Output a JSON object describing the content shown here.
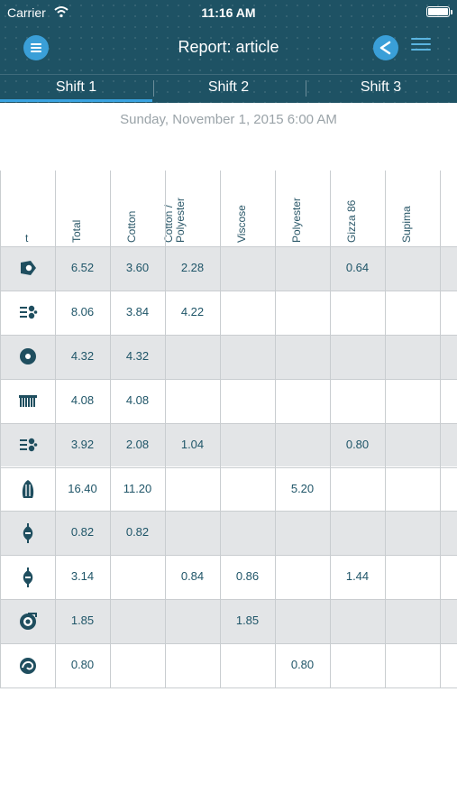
{
  "status_bar": {
    "carrier": "Carrier",
    "time": "11:16 AM"
  },
  "nav": {
    "title": "Report: article",
    "menu_icon": "menu-icon",
    "share_icon": "share-icon",
    "list_icon": "list-icon"
  },
  "tabs": [
    {
      "label": "Shift 1",
      "active": true
    },
    {
      "label": "Shift 2",
      "active": false
    },
    {
      "label": "Shift 3",
      "active": false
    }
  ],
  "date": "Sunday, November 1, 2015 6:00 AM",
  "table": {
    "first_header": "t",
    "columns": [
      {
        "line1": "Total"
      },
      {
        "line1": "Cotton"
      },
      {
        "line1": "Cotton /",
        "line2": "Polyester"
      },
      {
        "line1": "Viscose"
      },
      {
        "line1": "Polyester"
      },
      {
        "line1": "Gizza 86"
      },
      {
        "line1": "Supima"
      }
    ],
    "rows": [
      {
        "icon": "bale-opener-icon",
        "cells": [
          "6.52",
          "3.60",
          "2.28",
          "",
          "",
          "0.64",
          ""
        ]
      },
      {
        "icon": "blowroom-icon",
        "cells": [
          "8.06",
          "3.84",
          "4.22",
          "",
          "",
          "",
          ""
        ]
      },
      {
        "icon": "card-icon",
        "cells": [
          "4.32",
          "4.32",
          "",
          "",
          "",
          "",
          ""
        ]
      },
      {
        "icon": "comber-icon",
        "cells": [
          "4.08",
          "4.08",
          "",
          "",
          "",
          "",
          ""
        ]
      },
      {
        "icon": "blowroom-icon",
        "cells": [
          "3.92",
          "2.08",
          "1.04",
          "",
          "",
          "0.80",
          ""
        ]
      },
      {
        "icon": "draw-frame-icon",
        "cells": [
          "16.40",
          "11.20",
          "",
          "",
          "5.20",
          "",
          ""
        ]
      },
      {
        "icon": "roving-bobbin-icon",
        "cells": [
          "0.82",
          "0.82",
          "",
          "",
          "",
          "",
          ""
        ]
      },
      {
        "icon": "roving-bobbin-icon",
        "cells": [
          "3.14",
          "",
          "0.84",
          "0.86",
          "",
          "1.44",
          ""
        ]
      },
      {
        "icon": "spinning-icon",
        "cells": [
          "1.85",
          "",
          "",
          "1.85",
          "",
          "",
          ""
        ]
      },
      {
        "icon": "winding-icon",
        "cells": [
          "0.80",
          "",
          "",
          "",
          "0.80",
          "",
          ""
        ]
      }
    ]
  },
  "colors": {
    "header": "#1e5264",
    "accent": "#3a9fd8",
    "row_shade": "#e3e5e7",
    "grid": "#c9cdd0"
  }
}
